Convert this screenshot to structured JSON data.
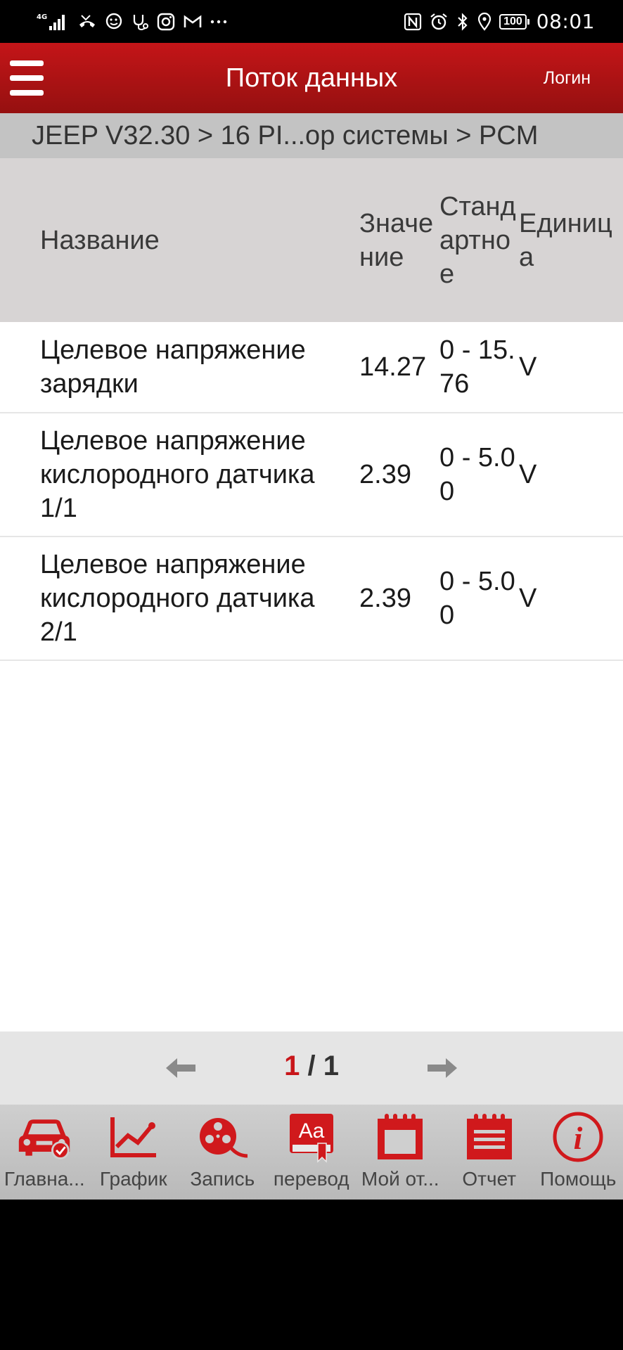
{
  "status_bar": {
    "network": "4G",
    "battery": "100",
    "time": "08:01"
  },
  "header": {
    "title": "Поток данных",
    "login_label": "Логин"
  },
  "breadcrumb": "JEEP V32.30 > 16 PI...ор системы > PCM",
  "table": {
    "columns": {
      "name": "Название",
      "value": "Значение",
      "standard": "Стандартное",
      "unit": "Единица"
    },
    "rows": [
      {
        "name": "Целевое напряжение зарядки",
        "value": "14.27",
        "standard": "0 - 15.76",
        "unit": "V"
      },
      {
        "name": "Целевое напряжение кислородного датчика 1/1",
        "value": "2.39",
        "standard": "0 - 5.00",
        "unit": "V"
      },
      {
        "name": "Целевое напряжение кислородного датчика 2/1",
        "value": "2.39",
        "standard": "0 - 5.00",
        "unit": "V"
      }
    ]
  },
  "pager": {
    "current": "1",
    "separator": "/",
    "total": "1"
  },
  "toolbar": {
    "items": [
      {
        "label": "Главна...",
        "icon": "car-icon"
      },
      {
        "label": "График",
        "icon": "graph-icon"
      },
      {
        "label": "Запись",
        "icon": "record-icon"
      },
      {
        "label": "перевод",
        "icon": "translate-icon"
      },
      {
        "label": "Мой от...",
        "icon": "calendar-icon"
      },
      {
        "label": "Отчет",
        "icon": "report-icon"
      },
      {
        "label": "Помощь",
        "icon": "help-icon"
      }
    ]
  },
  "colors": {
    "brand_red": "#c41518",
    "page_current": "#c8161a"
  }
}
